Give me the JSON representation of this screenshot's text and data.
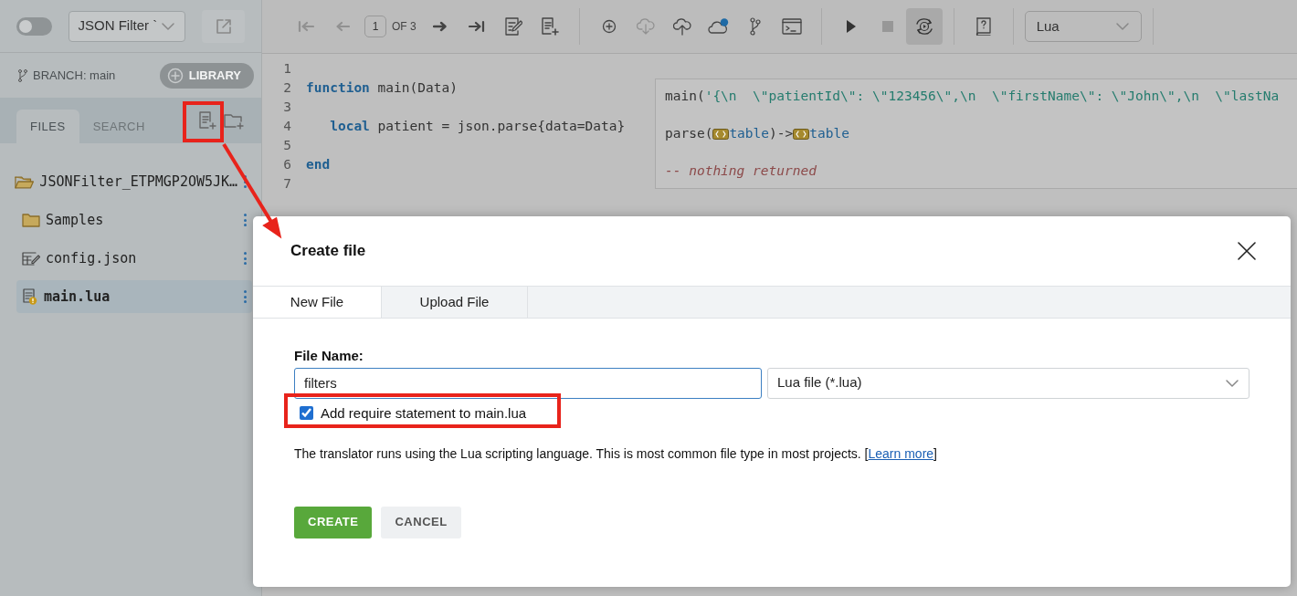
{
  "sidebar": {
    "toggle": {
      "on": false
    },
    "project_select": "JSON Filter `",
    "branch": "BRANCH: main",
    "library_button": "LIBRARY",
    "tabs": [
      {
        "label": "FILES",
        "selected": true
      },
      {
        "label": "SEARCH",
        "selected": false
      }
    ],
    "tree": [
      {
        "label": "JSONFilter_ETPMGP2OW5JK…",
        "kind": "folder",
        "expanded": true,
        "selected": false,
        "children": [
          {
            "label": "Samples",
            "kind": "folder",
            "expanded": false,
            "selected": false
          },
          {
            "label": "config.json",
            "kind": "config",
            "selected": false
          },
          {
            "label": "main.lua",
            "kind": "script",
            "selected": true,
            "warning": true
          }
        ]
      }
    ]
  },
  "toolbar": {
    "nav": [
      {
        "disabled": true
      },
      {
        "disabled": true
      }
    ],
    "page": "1",
    "page_total": "OF 3",
    "download_disabled": true,
    "cloud_notification": true,
    "stop_disabled": true,
    "loop_active": true,
    "language": "Lua"
  },
  "editor": {
    "lines": [
      {
        "number": "1"
      },
      {
        "number": "2",
        "tokens": [
          {
            "kind": "keyword",
            "text": "function"
          },
          {
            "kind": "plain",
            "text": " main(Data)"
          }
        ]
      },
      {
        "number": "3"
      },
      {
        "number": "4",
        "tokens": [
          {
            "kind": "keyword",
            "text": "   local"
          },
          {
            "kind": "plain",
            "text": " patient = json.parse{data=Data}"
          }
        ]
      },
      {
        "number": "5"
      },
      {
        "number": "6",
        "tokens": [
          {
            "kind": "keyword",
            "text": "end"
          }
        ]
      },
      {
        "number": "7"
      }
    ],
    "annotations": [
      {
        "tokens": [
          {
            "kind": "plain",
            "text": "main("
          },
          {
            "kind": "string",
            "text": "'{\\n  \\\"patientId\\\": \\\"123456\\\",\\n  \\\"firstName\\\": \\\"John\\\",\\n  \\\"lastNa"
          }
        ]
      },
      {
        "tokens": [
          {
            "kind": "plain",
            "text": "parse("
          },
          {
            "kind": "type_icon"
          },
          {
            "kind": "type",
            "text": "table"
          },
          {
            "kind": "plain",
            "text": ")->"
          },
          {
            "kind": "type_icon"
          },
          {
            "kind": "type",
            "text": "table"
          }
        ]
      },
      {
        "tokens": [
          {
            "kind": "comment",
            "text": "-- nothing returned"
          }
        ]
      }
    ]
  },
  "dialog": {
    "title": "Create file",
    "tabs": [
      {
        "label": "New File",
        "selected": true
      },
      {
        "label": "Upload File",
        "selected": false
      }
    ],
    "file_name_label": "File Name:",
    "file_name_value": "filters",
    "file_type": "Lua file (*.lua)",
    "require_checkbox": {
      "label": "Add require statement to main.lua",
      "checked": true
    },
    "description": {
      "text": "The translator runs using the Lua scripting language. This is most common file type in most projects. [",
      "link": "Learn more",
      "after": "]"
    },
    "buttons": [
      {
        "label": "CREATE",
        "kind": "primary"
      },
      {
        "label": "CANCEL",
        "kind": "secondary"
      }
    ]
  }
}
